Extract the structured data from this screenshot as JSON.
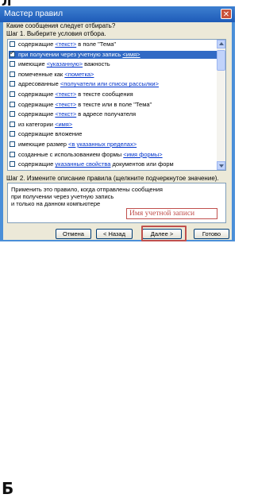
{
  "dialog": {
    "title": "Мастер правил",
    "close_glyph": "✕",
    "question": "Какие сообщения следует отбирать?",
    "step1_label": "Шаг 1. Выберите условия отбора.",
    "conditions": [
      {
        "checked": false,
        "selected": false,
        "before": "содержащие ",
        "link": "<текст>",
        "after": " в поле \"Тема\""
      },
      {
        "checked": true,
        "selected": true,
        "before": "при получении через учетную запись ",
        "link": "<имя>",
        "after": ""
      },
      {
        "checked": false,
        "selected": false,
        "before": "имеющие ",
        "link": "<указанную>",
        "after": " важность"
      },
      {
        "checked": false,
        "selected": false,
        "before": "помеченные как ",
        "link": "<пометка>",
        "after": ""
      },
      {
        "checked": false,
        "selected": false,
        "before": "адресованные ",
        "link": "<получатели или список рассылки>",
        "after": ""
      },
      {
        "checked": false,
        "selected": false,
        "before": "содержащие ",
        "link": "<текст>",
        "after": " в тексте сообщения"
      },
      {
        "checked": false,
        "selected": false,
        "before": "содержащие ",
        "link": "<текст>",
        "after": " в тексте или в поле \"Тема\""
      },
      {
        "checked": false,
        "selected": false,
        "before": "содержащие ",
        "link": "<текст>",
        "after": " в адресе получателя"
      },
      {
        "checked": false,
        "selected": false,
        "before": "из категории ",
        "link": "<имя>",
        "after": ""
      },
      {
        "checked": false,
        "selected": false,
        "before": "содержащие вложение",
        "link": "",
        "after": ""
      },
      {
        "checked": false,
        "selected": false,
        "before": "имеющие размер ",
        "link": "<в указанных пределах>",
        "after": ""
      },
      {
        "checked": false,
        "selected": false,
        "before": "созданные с использованием формы ",
        "link": "<имя формы>",
        "after": ""
      },
      {
        "checked": false,
        "selected": false,
        "before": "содержащие ",
        "link": "указанные свойства",
        "after": " документов или форм"
      }
    ],
    "step2_label": "Шаг 2. Измените описание правила (щелкните подчеркнутое значение).",
    "description_lines": [
      "Применить это правило, когда отправлены сообщения",
      "при получении через учетную запись",
      "  и только на данном компьютере"
    ],
    "annotation": "Имя учетной записи",
    "buttons": {
      "cancel": "Отмена",
      "back": "< Назад",
      "next": "Далее >",
      "finish": "Готово"
    }
  },
  "fragments": {
    "top_char": "Л",
    "bottom_char": "Б"
  }
}
